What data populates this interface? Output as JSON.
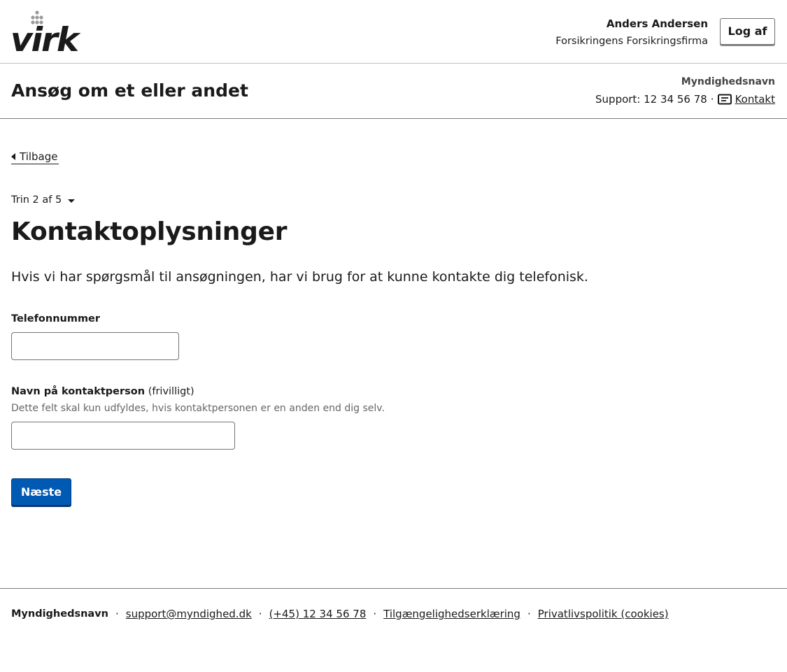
{
  "header": {
    "logo_text": "virk",
    "user_name": "Anders Andersen",
    "company_name": "Forsikringens Forsikringsfirma",
    "logout_label": "Log af"
  },
  "portal": {
    "title": "Ansøg om et eller andet",
    "authority_name": "Myndighedsnavn",
    "support_text": "Support: 12 34 56 78",
    "separator": "·",
    "contact_label": "Kontakt",
    "contact_icon": "message-icon"
  },
  "nav": {
    "back_label": "Tilbage",
    "back_icon": "triangle-left-icon",
    "step_label": "Trin 2 af 5",
    "step_icon": "caret-down-icon"
  },
  "main": {
    "title": "Kontaktoplysninger",
    "intro": "Hvis vi har spørgsmål til ansøgningen, har vi brug for at kunne kontakte dig telefonisk.",
    "phone": {
      "label": "Telefonnummer",
      "value": ""
    },
    "contact_person": {
      "label": "Navn på kontaktperson",
      "optional_suffix": "(frivilligt)",
      "help": "Dette felt skal kun udfyldes, hvis kontaktpersonen er en anden end dig selv.",
      "value": ""
    },
    "next_label": "Næste"
  },
  "footer": {
    "authority_name": "Myndighedsnavn",
    "separator": "·",
    "email": "support@myndighed.dk",
    "phone": "(+45) 12 34 56 78",
    "accessibility": "Tilgængelighedserklæring",
    "privacy": "Privatlivspolitik (cookies)"
  },
  "colors": {
    "primary_button": "#0059b3",
    "text": "#1a1a1a",
    "help_text": "#666666",
    "divider": "#7a7a7a"
  }
}
